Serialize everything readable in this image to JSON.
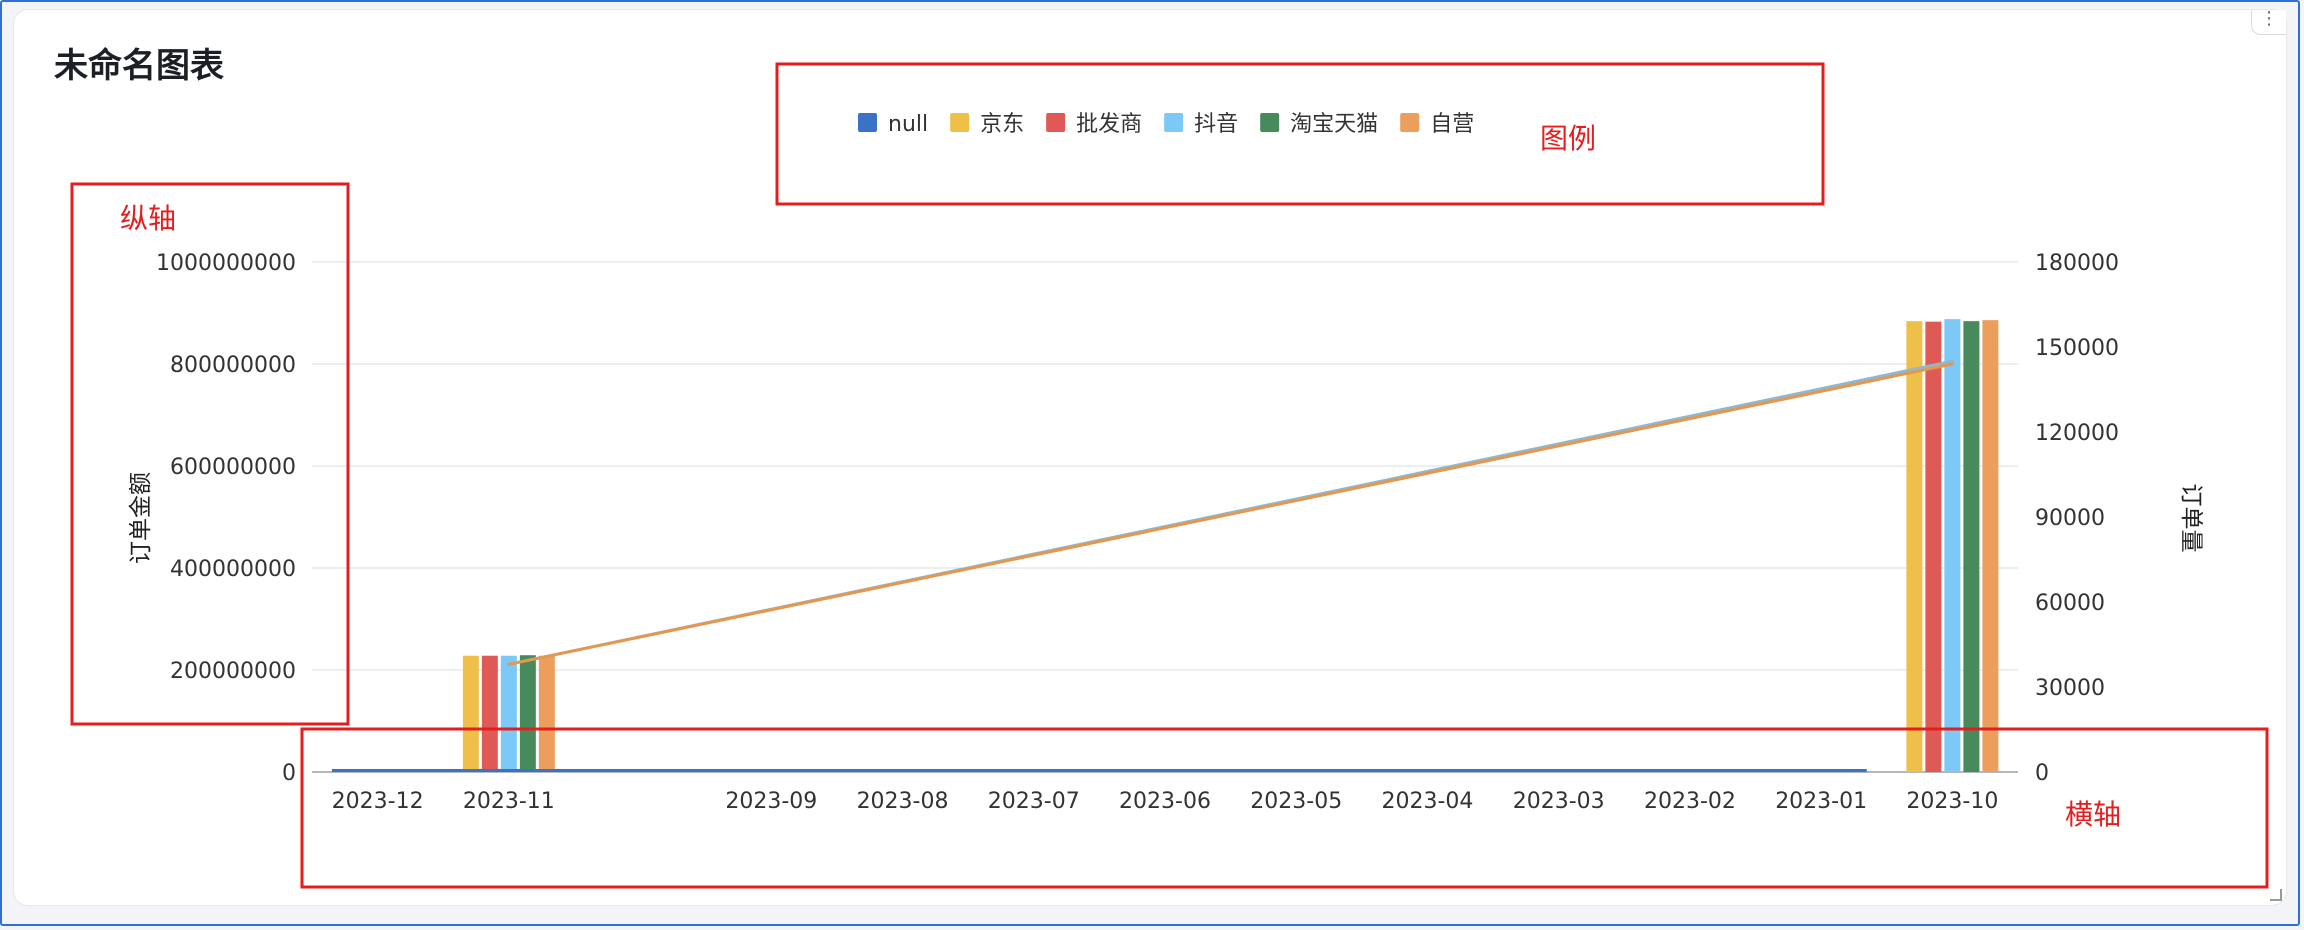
{
  "card": {
    "title": "未命名图表",
    "menu_glyph": "⋮"
  },
  "annotations": {
    "legend": "图例",
    "y_axis": "纵轴",
    "x_axis": "横轴"
  },
  "colors": {
    "null": "#3a72c8",
    "jd": "#eec04a",
    "wholesaler": "#df5a55",
    "douyin": "#7cc8f7",
    "taobao": "#478a5b",
    "self": "#ec9e5c",
    "line_a": "#8fb7cf",
    "line_b": "#e6974e",
    "annotation": "#e41e1e"
  },
  "chart_data": {
    "type": "bar",
    "title": "未命名图表",
    "ylabel": "订单金额",
    "y2label": "订单量",
    "ylim": [
      0,
      1000000000
    ],
    "y2lim": [
      0,
      180000
    ],
    "yticks": [
      0,
      200000000,
      400000000,
      600000000,
      800000000,
      1000000000
    ],
    "y2ticks": [
      0,
      30000,
      60000,
      90000,
      120000,
      150000,
      180000
    ],
    "legend_position": "top-center",
    "grid": true,
    "categories": [
      "2023-12",
      "2023-11",
      "",
      "2023-09",
      "2023-08",
      "2023-07",
      "2023-06",
      "2023-05",
      "2023-04",
      "2023-03",
      "2023-02",
      "2023-01",
      "2023-10"
    ],
    "series": [
      {
        "name": "null",
        "color_key": "null",
        "values": [
          2000000,
          2000000,
          2000000,
          2000000,
          2000000,
          2000000,
          2000000,
          2000000,
          2000000,
          2000000,
          2000000,
          2000000,
          0
        ]
      },
      {
        "name": "京东",
        "color_key": "jd",
        "values": [
          0,
          228000000,
          0,
          0,
          0,
          0,
          0,
          0,
          0,
          0,
          0,
          0,
          884000000
        ]
      },
      {
        "name": "批发商",
        "color_key": "wholesaler",
        "values": [
          0,
          228000000,
          0,
          0,
          0,
          0,
          0,
          0,
          0,
          0,
          0,
          0,
          883000000
        ]
      },
      {
        "name": "抖音",
        "color_key": "douyin",
        "values": [
          0,
          228000000,
          0,
          0,
          0,
          0,
          0,
          0,
          0,
          0,
          0,
          0,
          888000000
        ]
      },
      {
        "name": "淘宝天猫",
        "color_key": "taobao",
        "values": [
          0,
          229000000,
          0,
          0,
          0,
          0,
          0,
          0,
          0,
          0,
          0,
          0,
          884000000
        ]
      },
      {
        "name": "自营",
        "color_key": "self",
        "values": [
          0,
          228000000,
          0,
          0,
          0,
          0,
          0,
          0,
          0,
          0,
          0,
          0,
          886000000
        ]
      }
    ],
    "line_series": [
      {
        "color_key": "line_a",
        "points": [
          {
            "x": "2023-11",
            "y": 38000
          },
          {
            "x": "2023-10",
            "y": 145000
          }
        ]
      },
      {
        "color_key": "line_b",
        "points": [
          {
            "x": "2023-11",
            "y": 38000
          },
          {
            "x": "2023-10",
            "y": 144000
          }
        ]
      }
    ]
  }
}
